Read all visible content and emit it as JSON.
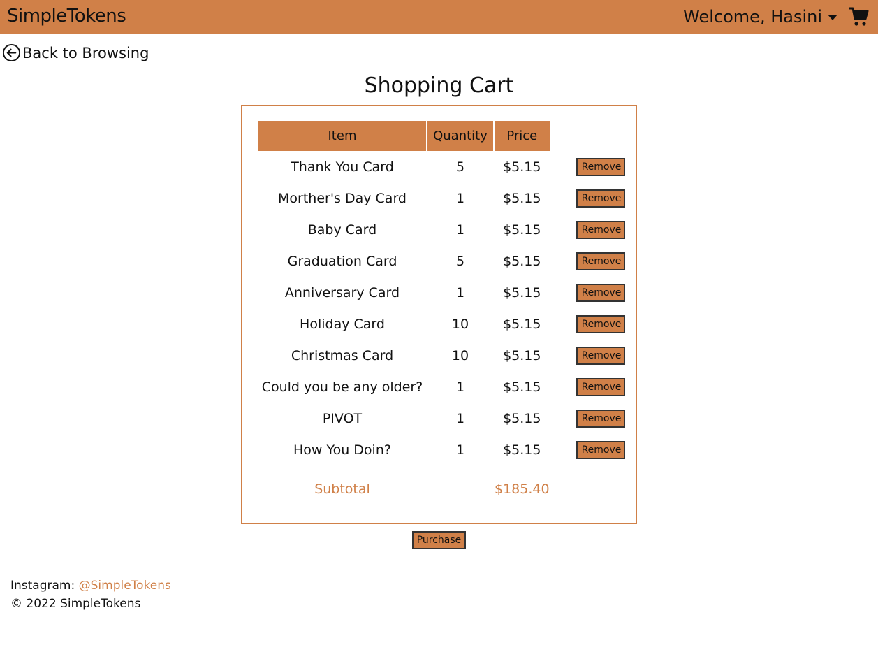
{
  "header": {
    "brand": "SimpleTokens",
    "welcome": "Welcome, Hasini",
    "accent_color": "#d08048",
    "icons": [
      "chevron-down-icon",
      "shopping-cart-icon"
    ]
  },
  "back_link": {
    "label": "Back to Browsing",
    "icon": "arrow-left-circle-icon"
  },
  "page_title": "Shopping Cart",
  "cart": {
    "columns": [
      "Item",
      "Quantity",
      "Price"
    ],
    "items": [
      {
        "name": "Thank You Card",
        "quantity": "5",
        "price": "$5.15",
        "action": "Remove"
      },
      {
        "name": "Morther's Day Card",
        "quantity": "1",
        "price": "$5.15",
        "action": "Remove"
      },
      {
        "name": "Baby Card",
        "quantity": "1",
        "price": "$5.15",
        "action": "Remove"
      },
      {
        "name": "Graduation Card",
        "quantity": "5",
        "price": "$5.15",
        "action": "Remove"
      },
      {
        "name": "Anniversary Card",
        "quantity": "1",
        "price": "$5.15",
        "action": "Remove"
      },
      {
        "name": "Holiday Card",
        "quantity": "10",
        "price": "$5.15",
        "action": "Remove"
      },
      {
        "name": "Christmas Card",
        "quantity": "10",
        "price": "$5.15",
        "action": "Remove"
      },
      {
        "name": "Could you be any older?",
        "quantity": "1",
        "price": "$5.15",
        "action": "Remove"
      },
      {
        "name": "PIVOT",
        "quantity": "1",
        "price": "$5.15",
        "action": "Remove"
      },
      {
        "name": "How You Doin?",
        "quantity": "1",
        "price": "$5.15",
        "action": "Remove"
      }
    ],
    "subtotal_label": "Subtotal",
    "subtotal_value": "$185.40"
  },
  "purchase_label": "Purchase",
  "footer": {
    "instagram_label": "Instagram:",
    "instagram_handle": "@SimpleTokens",
    "copyright": "© 2022 SimpleTokens"
  }
}
